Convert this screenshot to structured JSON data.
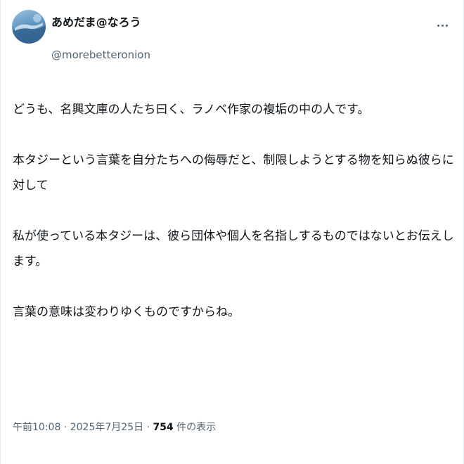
{
  "author": {
    "display_name": "あめだま@なろう",
    "handle": "@morebetteronion"
  },
  "menu": {
    "icon": "more-horizontal-icon"
  },
  "tweet": {
    "paragraphs": [
      "どうも、名興文庫の人たち曰く、ラノベ作家の複垢の中の人です。",
      "本タジーという言葉を自分たちへの侮辱だと、制限しようとする物を知らぬ彼らに対して",
      "私が使っている本タジーは、彼ら団体や個人を名指しするものではないとお伝えします。",
      "言葉の意味は変わりゆくものですからね。"
    ]
  },
  "meta": {
    "time": "午前10:08",
    "separator": "·",
    "date": "2025年7月25日",
    "views_count": "754",
    "views_label": "件の表示"
  }
}
